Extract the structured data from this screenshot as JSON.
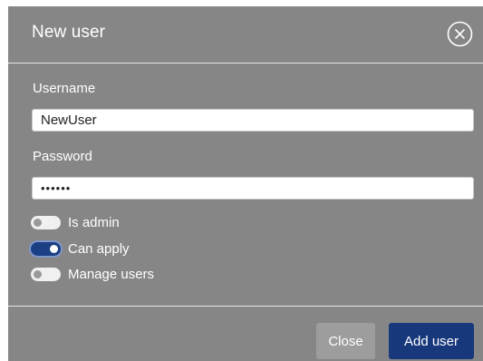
{
  "dialog": {
    "title": "New user",
    "close_icon": "close-circle-icon"
  },
  "form": {
    "username_label": "Username",
    "username_value": "NewUser",
    "password_label": "Password",
    "password_value": "••••••"
  },
  "permissions": [
    {
      "label": "Is admin",
      "checked": false
    },
    {
      "label": "Can apply",
      "checked": true
    },
    {
      "label": "Manage users",
      "checked": false
    }
  ],
  "footer": {
    "close_label": "Close",
    "add_label": "Add user"
  },
  "colors": {
    "dialog_bg": "#868686",
    "primary": "#17387b",
    "secondary": "#9d9d9d",
    "toggle_on": "#1b3f84"
  }
}
